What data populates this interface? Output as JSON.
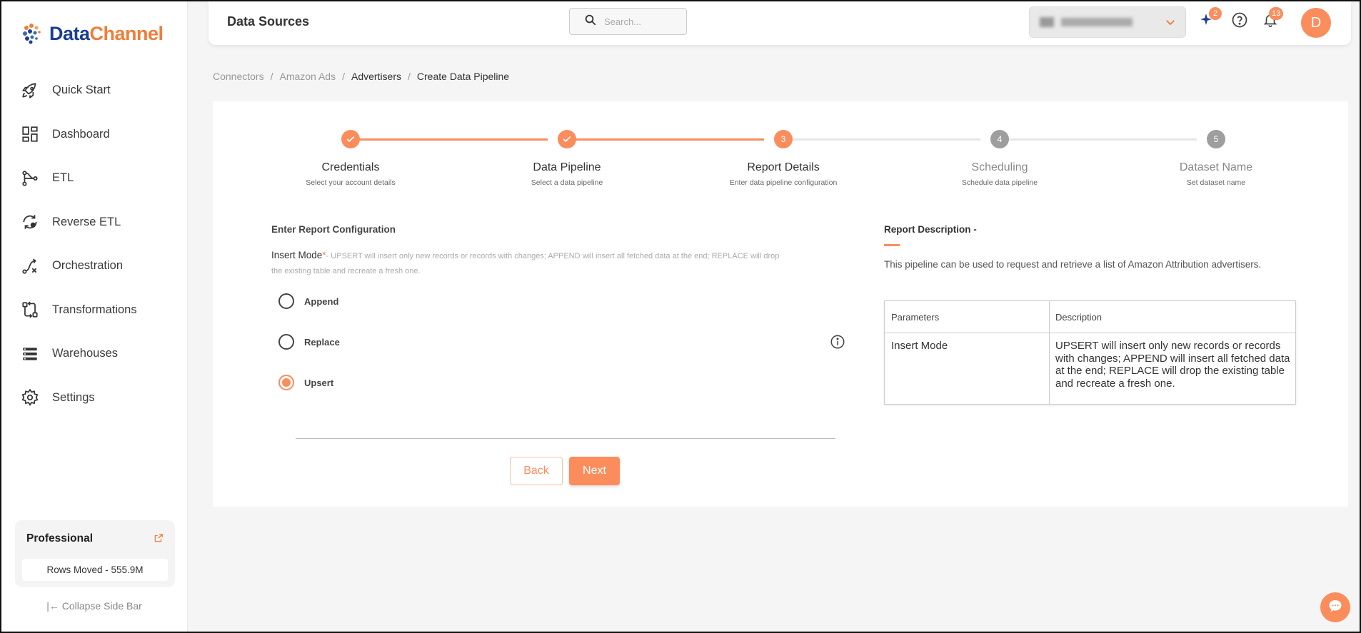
{
  "brand": {
    "part1": "Data",
    "part2": "Channel"
  },
  "sidebar": {
    "items": [
      {
        "label": "Quick Start",
        "icon": "rocket-icon"
      },
      {
        "label": "Dashboard",
        "icon": "dashboard-icon"
      },
      {
        "label": "ETL",
        "icon": "etl-icon"
      },
      {
        "label": "Reverse ETL",
        "icon": "reverse-etl-icon"
      },
      {
        "label": "Orchestration",
        "icon": "orchestration-icon"
      },
      {
        "label": "Transformations",
        "icon": "transformations-icon"
      },
      {
        "label": "Warehouses",
        "icon": "warehouses-icon"
      },
      {
        "label": "Settings",
        "icon": "gear-icon"
      }
    ],
    "plan": {
      "title": "Professional",
      "rows": "Rows Moved - 555.9M"
    },
    "collapse": "|← Collapse Side Bar"
  },
  "header": {
    "title": "Data Sources",
    "search_placeholder": "Search...",
    "ai_badge": "2",
    "notif_badge": "13",
    "avatar": "D"
  },
  "breadcrumb": [
    "Connectors",
    "Amazon Ads",
    "Advertisers",
    "Create Data Pipeline"
  ],
  "steps": [
    {
      "num": "1",
      "title": "Credentials",
      "sub": "Select your account details",
      "state": "done"
    },
    {
      "num": "2",
      "title": "Data Pipeline",
      "sub": "Select a data pipeline",
      "state": "done"
    },
    {
      "num": "3",
      "title": "Report Details",
      "sub": "Enter data pipeline configuration",
      "state": "active"
    },
    {
      "num": "4",
      "title": "Scheduling",
      "sub": "Schedule data pipeline",
      "state": "pending"
    },
    {
      "num": "5",
      "title": "Dataset Name",
      "sub": "Set dataset name",
      "state": "pending"
    }
  ],
  "form": {
    "heading": "Enter Report Configuration",
    "insert_mode_label": "Insert Mode",
    "required_mark": "*",
    "insert_mode_desc": "- UPSERT will insert only new records or records with changes; APPEND will insert all fetched data at the end; REPLACE will drop the existing table and recreate a fresh one.",
    "options": [
      {
        "label": "Append",
        "selected": false
      },
      {
        "label": "Replace",
        "selected": false
      },
      {
        "label": "Upsert",
        "selected": true
      }
    ],
    "back": "Back",
    "next": "Next"
  },
  "report": {
    "title": "Report Description -",
    "text": "This pipeline can be used to request and retrieve a list of Amazon Attribution advertisers.",
    "table_headers": [
      "Parameters",
      "Description"
    ],
    "rows": [
      {
        "param": "Insert Mode",
        "desc": "UPSERT will insert only new records or records with changes; APPEND will insert all fetched data at the end; REPLACE will drop the existing table and recreate a fresh one."
      }
    ]
  },
  "colors": {
    "accent": "#fb8d5d",
    "brand_blue": "#1b3f8f",
    "step_pending": "#9e9e9e"
  }
}
